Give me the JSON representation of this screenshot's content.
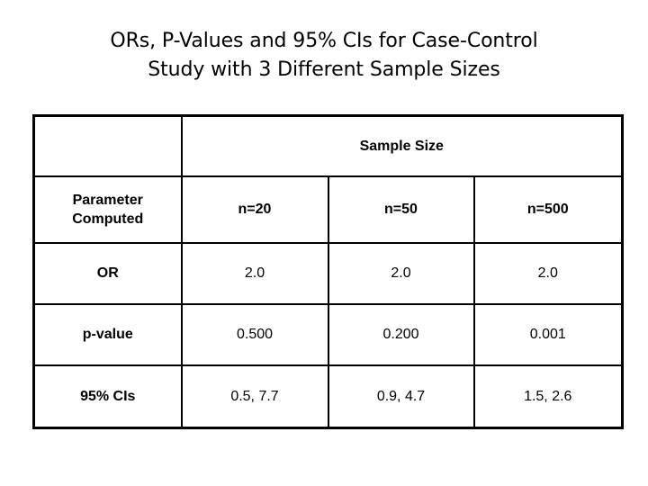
{
  "slide": {
    "title_lines": [
      "ORs, P-Values and 95% CIs for Case-Control",
      "Study with 3 Different Sample Sizes"
    ],
    "colors": {
      "text": "#000000",
      "background": "#ffffff",
      "border": "#000000"
    }
  },
  "table": {
    "group_header": "Sample Size",
    "corner_cell": "",
    "row_header_label_line1": "Parameter",
    "row_header_label_line2": "Computed",
    "column_headers": [
      "n=20",
      "n=50",
      "n=500"
    ],
    "rows": [
      {
        "label": "OR",
        "values": [
          "2.0",
          "2.0",
          "2.0"
        ]
      },
      {
        "label": "p-value",
        "values": [
          "0.500",
          "0.200",
          "0.001"
        ]
      },
      {
        "label": "95% CIs",
        "values": [
          "0.5, 7.7",
          "0.9, 4.7",
          "1.5, 2.6"
        ]
      }
    ]
  },
  "chart_data": {
    "type": "table",
    "title": "ORs, P-Values and 95% CIs for Case-Control Study with 3 Different Sample Sizes",
    "column_group": "Sample Size",
    "row_label_header": "Parameter Computed",
    "categories": [
      "n=20",
      "n=50",
      "n=500"
    ],
    "sample_sizes": [
      20,
      50,
      500
    ],
    "series": [
      {
        "name": "OR",
        "values": [
          2.0,
          2.0,
          2.0
        ]
      },
      {
        "name": "p-value",
        "values": [
          0.5,
          0.2,
          0.001
        ]
      },
      {
        "name": "95% CIs lower",
        "values": [
          0.5,
          0.9,
          1.5
        ]
      },
      {
        "name": "95% CIs upper",
        "values": [
          7.7,
          4.7,
          2.6
        ]
      }
    ],
    "rows": [
      {
        "label": "OR",
        "values": [
          "2.0",
          "2.0",
          "2.0"
        ]
      },
      {
        "label": "p-value",
        "values": [
          "0.500",
          "0.200",
          "0.001"
        ]
      },
      {
        "label": "95% CIs",
        "values": [
          "0.5, 7.7",
          "0.9, 4.7",
          "1.5, 2.6"
        ]
      }
    ],
    "grid": true,
    "legend": "none"
  }
}
